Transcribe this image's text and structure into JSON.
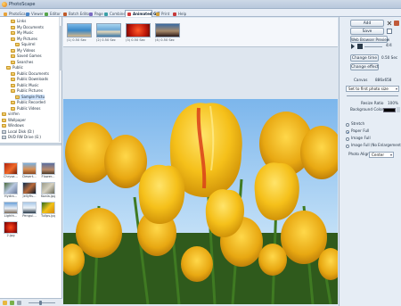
{
  "window": {
    "title": "PhotoScape"
  },
  "tabs": [
    {
      "label": "PhotoScape",
      "color": "#e8a33a",
      "active": false
    },
    {
      "label": "Viewer",
      "color": "#4a87c9",
      "active": false
    },
    {
      "label": "Editor",
      "color": "#56a54a",
      "active": false
    },
    {
      "label": "Batch Editor",
      "color": "#c05a2a",
      "active": false
    },
    {
      "label": "Page",
      "color": "#7a6ac2",
      "active": false
    },
    {
      "label": "Combine",
      "color": "#3aa0a8",
      "active": false
    },
    {
      "label": "Animated GIF",
      "color": "#d23a3a",
      "active": true
    },
    {
      "label": "Print",
      "color": "#d2a03a",
      "active": false
    },
    {
      "label": "Help",
      "color": "#c83a3a",
      "active": false
    }
  ],
  "folder_tree": [
    {
      "label": "Links",
      "indent": 2,
      "icon": "folder"
    },
    {
      "label": "My Documents",
      "indent": 2,
      "icon": "folder"
    },
    {
      "label": "My Music",
      "indent": 2,
      "icon": "folder"
    },
    {
      "label": "My Pictures",
      "indent": 2,
      "icon": "folder"
    },
    {
      "label": "Squirrel",
      "indent": 3,
      "icon": "folder"
    },
    {
      "label": "My Videos",
      "indent": 2,
      "icon": "folder"
    },
    {
      "label": "Saved Games",
      "indent": 2,
      "icon": "folder"
    },
    {
      "label": "Searches",
      "indent": 2,
      "icon": "folder"
    },
    {
      "label": "Public",
      "indent": 1,
      "icon": "folder"
    },
    {
      "label": "Public Documents",
      "indent": 2,
      "icon": "folder"
    },
    {
      "label": "Public Downloads",
      "indent": 2,
      "icon": "folder"
    },
    {
      "label": "Public Music",
      "indent": 2,
      "icon": "folder"
    },
    {
      "label": "Public Pictures",
      "indent": 2,
      "icon": "folder"
    },
    {
      "label": "Sample Pictu",
      "indent": 3,
      "icon": "folder",
      "selected": true
    },
    {
      "label": "Public Recorded",
      "indent": 2,
      "icon": "folder"
    },
    {
      "label": "Public Videos",
      "indent": 2,
      "icon": "folder"
    },
    {
      "label": "virifen",
      "indent": 0,
      "icon": "folder"
    },
    {
      "label": "Wallpaper",
      "indent": 0,
      "icon": "folder"
    },
    {
      "label": "Windows",
      "indent": 0,
      "icon": "folder"
    },
    {
      "label": "Local Disk (D:)",
      "indent": 0,
      "icon": "drive"
    },
    {
      "label": "DVD RW Drive (E:)",
      "indent": 0,
      "icon": "drive"
    }
  ],
  "files": [
    {
      "name": "Chrysa...",
      "bg": "linear-gradient(135deg,#b0230e,#f06a2a 55%,#6a1a08)"
    },
    {
      "name": "Desert...",
      "bg": "linear-gradient(180deg,#7ab0e0,#d99055 55%,#8a4a22)"
    },
    {
      "name": "Flower...",
      "bg": "linear-gradient(180deg,#5a6ea0,#b98a6a 60%,#4a3a2a)"
    },
    {
      "name": "Hydra...",
      "bg": "linear-gradient(135deg,#4a6a3a,#b8c8e0 50%,#6a7a9a)"
    },
    {
      "name": "Jellyfis...",
      "bg": "linear-gradient(135deg,#0a2a4a,#b86a3a 50%,#0a1a2a)"
    },
    {
      "name": "Koala.jpg",
      "bg": "linear-gradient(135deg,#9a9a88,#d4d0c0 50%,#6a6a5a)"
    },
    {
      "name": "Lighth...",
      "bg": "linear-gradient(180deg,#6aa0d8,#e8eef6 55%,#7a6a5a)"
    },
    {
      "name": "Pengui...",
      "bg": "linear-gradient(180deg,#a8c8e8,#eef4fa 50%,#2a3a4a)"
    },
    {
      "name": "Tulips.jpg",
      "bg": "linear-gradient(135deg,#2a6a1a,#f2c21a 50%,#d88a0a)"
    },
    {
      "name": "2.jpg",
      "bg": "radial-gradient(circle at 50% 50%,#ff4a1a,#b0150a 60%,#5a0a05)"
    }
  ],
  "frames": [
    {
      "caption": "(1) 0.50 Sec",
      "bg": "linear-gradient(180deg,#7ab8e8,#3a88c8 50%,#d8b888)"
    },
    {
      "caption": "(2) 0.50 Sec",
      "bg": "linear-gradient(180deg,#a8d4f0,#6aa8d8 45%,#e6d8b8 60%,#3a78a8)"
    },
    {
      "caption": "(3) 0.50 Sec",
      "bg": "radial-gradient(circle at 50% 50%,#ff5a2a,#c0180a 60%,#6a0a05)"
    },
    {
      "caption": "(4) 0.50 Sec",
      "bg": "linear-gradient(180deg,#3a6aa0,#a88a6a 55%,#2a1a1a)"
    }
  ],
  "right": {
    "add": "Add",
    "save": "Save",
    "web_preview": "Web Browser Preview",
    "counter": "4/4",
    "change_time": "Change time",
    "time_value": "0.50 Sec",
    "change_effect": "Change effect",
    "canvas_label": "Canvas",
    "canvas_value": "886x658",
    "size_select": "Set to first photo size",
    "resize_ratio_label": "Resize Ratio",
    "resize_ratio_value": "100%",
    "bg_color_label": "Background Color",
    "bg_color": "#000000",
    "stretch": "Stretch",
    "paper_full": "Paper Full",
    "image_full": "Image Full",
    "image_full_no_enlarge": "Image Full (No Enlargement",
    "photo_align_label": "Photo Align",
    "photo_align_value": "Center"
  }
}
